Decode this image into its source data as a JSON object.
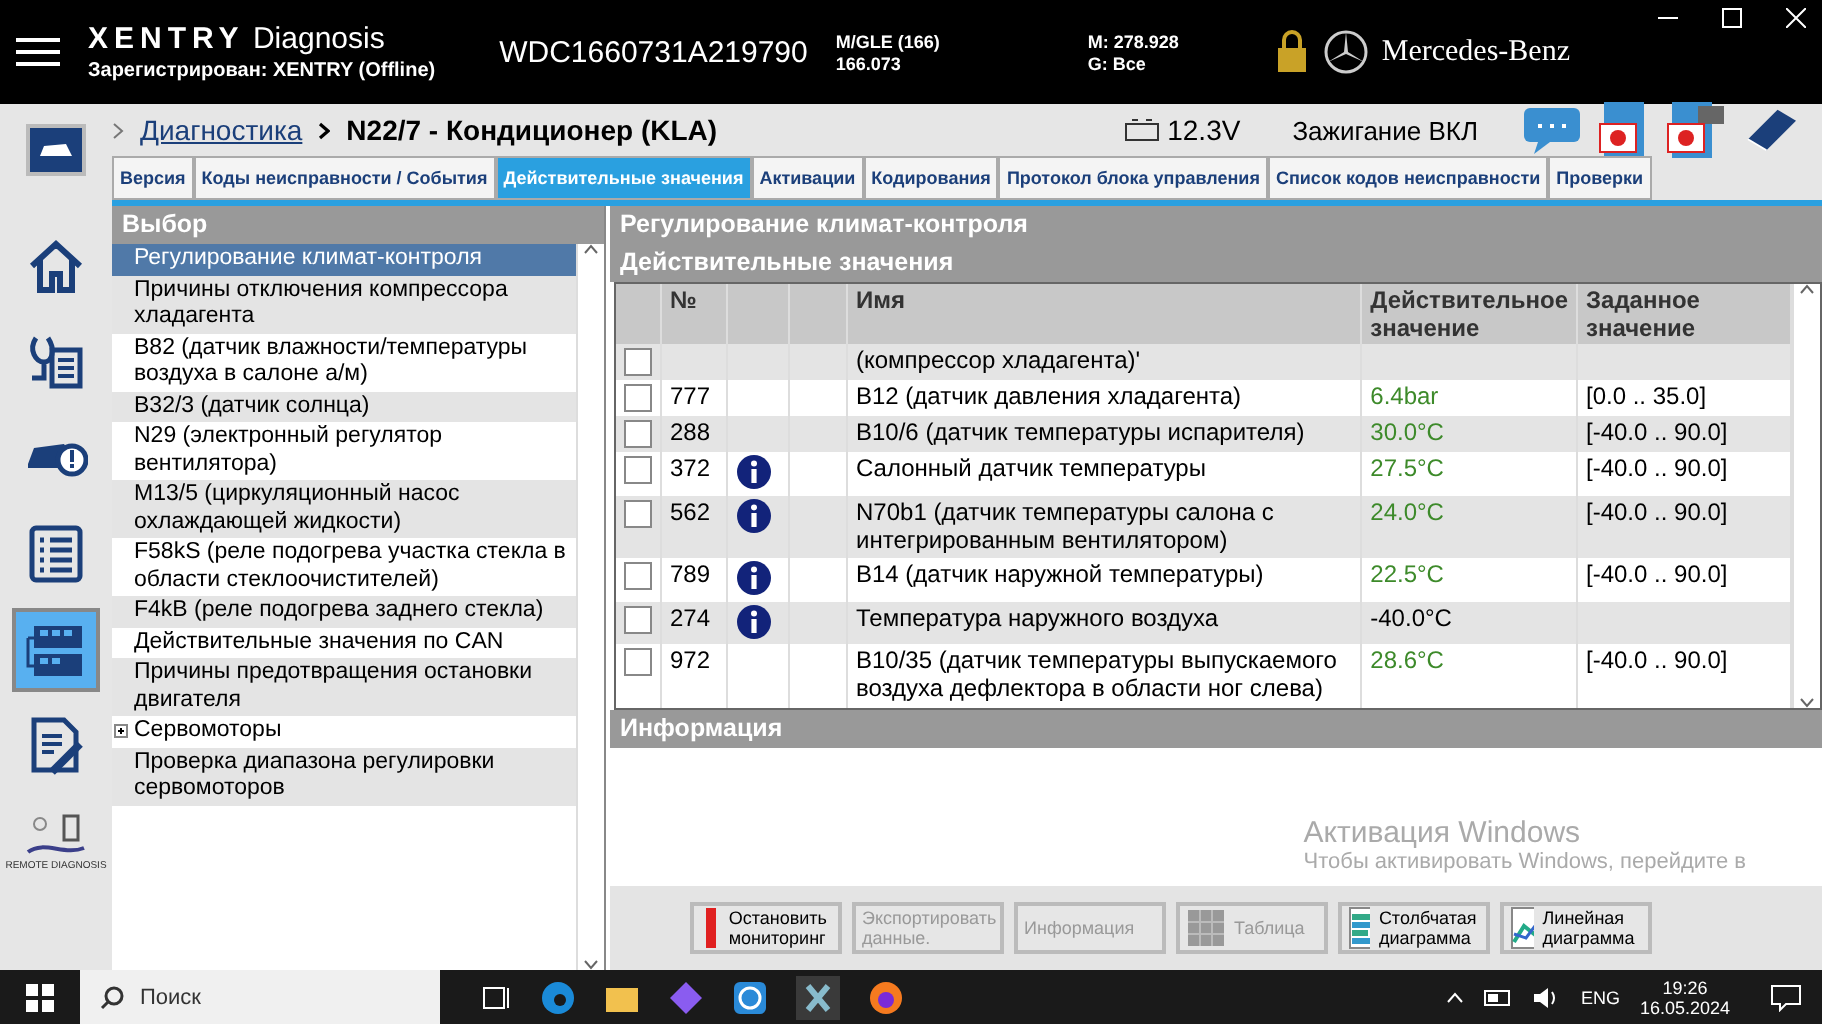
{
  "app": {
    "title": "XENTRY",
    "subtitle": "Diagnosis",
    "registered": "Зарегистрирован: XENTRY (Offline)",
    "vin": "WDC1660731A219790",
    "model": [
      "M/GLE (166)",
      "166.073"
    ],
    "engine": [
      "M: 278.928",
      "G: Все"
    ],
    "brand": "Mercedes-Benz"
  },
  "breadcrumb": {
    "items": [
      "Диагностика",
      "N22/7 - Кондиционер (KLA)"
    ],
    "voltage": "12.3V",
    "ignition": "Зажигание ВКЛ"
  },
  "nav": [
    {
      "kind": "home",
      "selected": false
    },
    {
      "kind": "doctor",
      "selected": false
    },
    {
      "kind": "car",
      "selected": false
    },
    {
      "kind": "list",
      "selected": false
    },
    {
      "kind": "units",
      "selected": true
    },
    {
      "kind": "tools",
      "selected": false
    },
    {
      "kind": "remote",
      "selected": false,
      "label": "REMOTE DIAGNOSIS"
    }
  ],
  "tabs": [
    {
      "label": "Версия",
      "selected": false
    },
    {
      "label": "Коды неисправности / События",
      "selected": false
    },
    {
      "label": "Действительные значения",
      "selected": true
    },
    {
      "label": "Активации",
      "selected": false
    },
    {
      "label": "Кодирования",
      "selected": false
    },
    {
      "label": "Протокол блока управления",
      "selected": false
    },
    {
      "label": "Список кодов неисправности",
      "selected": false
    },
    {
      "label": "Проверки",
      "selected": false
    }
  ],
  "selection": {
    "title": "Выбор",
    "items": [
      {
        "label": "Регулирование климат-контроля",
        "selected": true,
        "expandable": false
      },
      {
        "label": "Причины отключения компрессора хладагента",
        "selected": false
      },
      {
        "label": "B82 (датчик влажности/температуры воздуха в салоне а/м)",
        "selected": false
      },
      {
        "label": "B32/3 (датчик солнца)",
        "selected": false
      },
      {
        "label": "N29 (электронный регулятор вентилятора)",
        "selected": false
      },
      {
        "label": "M13/5 (циркуляционный насос охлаждающей жидкости)",
        "selected": false
      },
      {
        "label": "F58kS (реле подогрева участка стекла в области стеклоочистителей)",
        "selected": false
      },
      {
        "label": "F4kB (реле подогрева заднего стекла)",
        "selected": false
      },
      {
        "label": "Действительные значения по CAN",
        "selected": false
      },
      {
        "label": "Причины предотвращения остановки двигателя",
        "selected": false
      },
      {
        "label": "Сервомоторы",
        "selected": false,
        "expandable": true
      },
      {
        "label": "Проверка диапазона регулировки сервомоторов",
        "selected": false
      }
    ]
  },
  "values": {
    "title": "Регулирование климат-контроля",
    "subtitle": "Действительные значения",
    "columns": [
      "№",
      "Имя",
      "Действительное значение",
      "Заданное значение"
    ],
    "rows": [
      {
        "name": "(компрессор хладагента)'",
        "info": false,
        "checked": false
      },
      {
        "number": "777",
        "name": "B12 (датчик давления хладагента)",
        "info": false,
        "value": "6.4bar",
        "value_ok": true,
        "setpoint": "[0.0 .. 35.0]",
        "checked": false
      },
      {
        "number": "288",
        "name": "B10/6 (датчик температуры испарителя)",
        "info": false,
        "value": "30.0°C",
        "value_ok": true,
        "setpoint": "[-40.0 .. 90.0]",
        "checked": false
      },
      {
        "number": "372",
        "name": "Салонный датчик температуры",
        "info": true,
        "value": "27.5°C",
        "value_ok": true,
        "setpoint": "[-40.0 .. 90.0]",
        "checked": false
      },
      {
        "number": "562",
        "name": "N70b1 (датчик температуры салона с интегрированным вентилятором)",
        "info": true,
        "value": "24.0°C",
        "value_ok": true,
        "setpoint": "[-40.0 .. 90.0]",
        "checked": false
      },
      {
        "number": "789",
        "name": "B14 (датчик наружной температуры)",
        "info": true,
        "value": "22.5°C",
        "value_ok": true,
        "setpoint": "[-40.0 .. 90.0]",
        "checked": false
      },
      {
        "number": "274",
        "name": "Температура наружного воздуха",
        "info": true,
        "value": "-40.0°C",
        "value_ok": false,
        "checked": false
      },
      {
        "number": "972",
        "name": "B10/35 (датчик температуры выпускаемого воздуха дефлектора в области ног слева)",
        "info": false,
        "value": "28.6°C",
        "value_ok": true,
        "setpoint": "[-40.0 .. 90.0]",
        "checked": false
      }
    ]
  },
  "info": {
    "title": "Информация"
  },
  "activation_notice": [
    "Активация Windows",
    "Чтобы активировать Windows, перейдите в"
  ],
  "toolbar": [
    {
      "kind": "stop",
      "label": "Остановить мониторинг",
      "disabled": false
    },
    {
      "kind": "export",
      "label": "Экспортировать данные.",
      "disabled": true
    },
    {
      "kind": "info",
      "label": "Информация",
      "disabled": true
    },
    {
      "kind": "table",
      "label": "Таблица",
      "disabled": true
    },
    {
      "kind": "bars",
      "label": "Столбчатая диаграмма",
      "disabled": false
    },
    {
      "kind": "line",
      "label": "Линейная диаграмма",
      "disabled": false
    }
  ],
  "taskbar": {
    "search": "Поиск",
    "language": "ENG",
    "time": "19:26",
    "date": "16.05.2024"
  }
}
